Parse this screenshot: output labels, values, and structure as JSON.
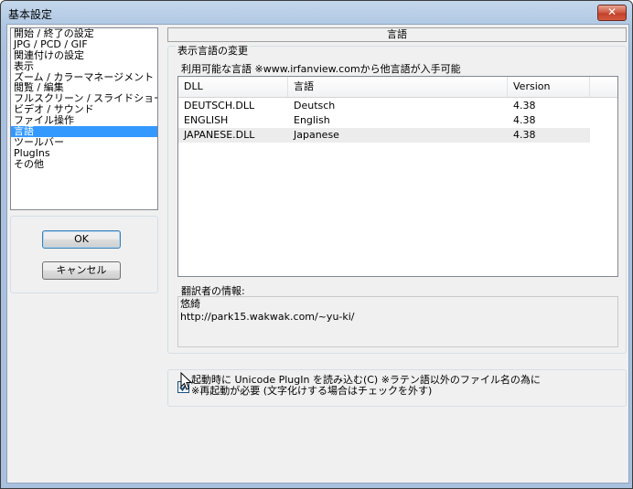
{
  "window": {
    "title": "基本設定",
    "close_glyph": "✕"
  },
  "categories": [
    {
      "label": "開始 / 終了の設定",
      "selected": false
    },
    {
      "label": "JPG / PCD / GIF",
      "selected": false
    },
    {
      "label": "関連付けの設定",
      "selected": false
    },
    {
      "label": "表示",
      "selected": false
    },
    {
      "label": "ズーム / カラーマネージメント",
      "selected": false
    },
    {
      "label": "閲覧 / 編集",
      "selected": false
    },
    {
      "label": "フルスクリーン / スライドショー",
      "selected": false
    },
    {
      "label": "ビデオ / サウンド",
      "selected": false
    },
    {
      "label": "ファイル操作",
      "selected": false
    },
    {
      "label": "言語",
      "selected": true
    },
    {
      "label": "ツールバー",
      "selected": false
    },
    {
      "label": "PlugIns",
      "selected": false
    },
    {
      "label": "その他",
      "selected": false
    }
  ],
  "buttons": {
    "ok": "OK",
    "cancel": "キャンセル"
  },
  "page": {
    "header": "言語",
    "group_label": "表示言語の変更",
    "available_label": "利用可能な言語 ※www.irfanview.comから他言語が入手可能",
    "columns": [
      "DLL",
      "言語",
      "Version"
    ],
    "rows": [
      {
        "dll": "DEUTSCH.DLL",
        "language": "Deutsch",
        "version": "4.38",
        "selected": false
      },
      {
        "dll": "ENGLISH",
        "language": "English",
        "version": "4.38",
        "selected": false
      },
      {
        "dll": "JAPANESE.DLL",
        "language": "Japanese",
        "version": "4.38",
        "selected": true
      }
    ],
    "translator_label": "翻訳者の情報:",
    "translator_info": "悠綺\nhttp://park15.wakwak.com/~yu-ki/",
    "unicode_checkbox": {
      "checked": true,
      "label": "起動時に Unicode PlugIn を読み込む(C) ※ラテン語以外のファイル名の為に\n※再起動が必要 (文字化けする場合はチェックを外す)"
    }
  },
  "colors": {
    "selection": "#3399ff",
    "title_gradient": "#aec6e2",
    "close_button": "#c2412a"
  }
}
